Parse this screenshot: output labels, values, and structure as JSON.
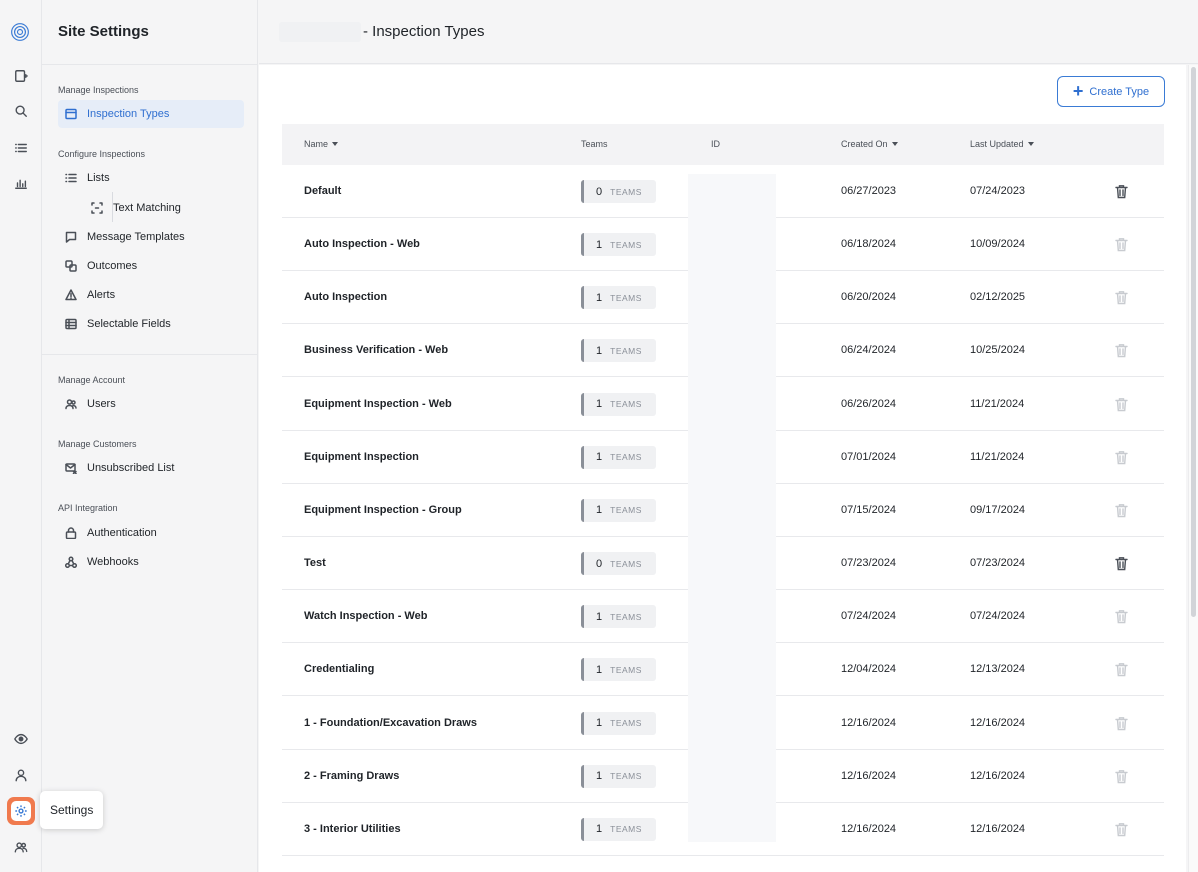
{
  "rail": {
    "tooltip": "Settings",
    "icons": [
      "logo-icon",
      "new-inspection-icon",
      "search-icon",
      "list-icon",
      "chart-icon",
      "eye-icon",
      "user-icon",
      "settings-icon",
      "users-icon"
    ]
  },
  "sidebar": {
    "title": "Site Settings",
    "sections": {
      "manage_inspections": "Manage Inspections",
      "configure_inspections": "Configure Inspections",
      "manage_account": "Manage Account",
      "manage_customers": "Manage Customers",
      "api_integration": "API Integration"
    },
    "items": {
      "inspection_types": "Inspection Types",
      "lists": "Lists",
      "text_matching": "Text Matching",
      "message_templates": "Message Templates",
      "outcomes": "Outcomes",
      "alerts": "Alerts",
      "selectable_fields": "Selectable Fields",
      "users": "Users",
      "unsubscribed_list": "Unsubscribed List",
      "authentication": "Authentication",
      "webhooks": "Webhooks"
    }
  },
  "header": {
    "title": "- Inspection Types"
  },
  "toolbar": {
    "create_label": "Create Type"
  },
  "table": {
    "columns": {
      "name": "Name",
      "teams": "Teams",
      "id": "ID",
      "created": "Created On",
      "updated": "Last Updated"
    },
    "teams_unit": "TEAMS",
    "rows": [
      {
        "name": "Default",
        "teams": "0",
        "created": "06/27/2023",
        "updated": "07/24/2023"
      },
      {
        "name": "Auto Inspection - Web",
        "teams": "1",
        "created": "06/18/2024",
        "updated": "10/09/2024"
      },
      {
        "name": "Auto Inspection",
        "teams": "1",
        "created": "06/20/2024",
        "updated": "02/12/2025"
      },
      {
        "name": "Business Verification - Web",
        "teams": "1",
        "created": "06/24/2024",
        "updated": "10/25/2024"
      },
      {
        "name": "Equipment Inspection - Web",
        "teams": "1",
        "created": "06/26/2024",
        "updated": "11/21/2024"
      },
      {
        "name": "Equipment Inspection",
        "teams": "1",
        "created": "07/01/2024",
        "updated": "11/21/2024"
      },
      {
        "name": "Equipment Inspection - Group",
        "teams": "1",
        "created": "07/15/2024",
        "updated": "09/17/2024"
      },
      {
        "name": "Test",
        "teams": "0",
        "created": "07/23/2024",
        "updated": "07/23/2024"
      },
      {
        "name": "Watch Inspection - Web",
        "teams": "1",
        "created": "07/24/2024",
        "updated": "07/24/2024"
      },
      {
        "name": "Credentialing",
        "teams": "1",
        "created": "12/04/2024",
        "updated": "12/13/2024"
      },
      {
        "name": "1 - Foundation/Excavation Draws",
        "teams": "1",
        "created": "12/16/2024",
        "updated": "12/16/2024"
      },
      {
        "name": "2 - Framing Draws",
        "teams": "1",
        "created": "12/16/2024",
        "updated": "12/16/2024"
      },
      {
        "name": "3 - Interior Utilities",
        "teams": "1",
        "created": "12/16/2024",
        "updated": "12/16/2024"
      }
    ]
  }
}
